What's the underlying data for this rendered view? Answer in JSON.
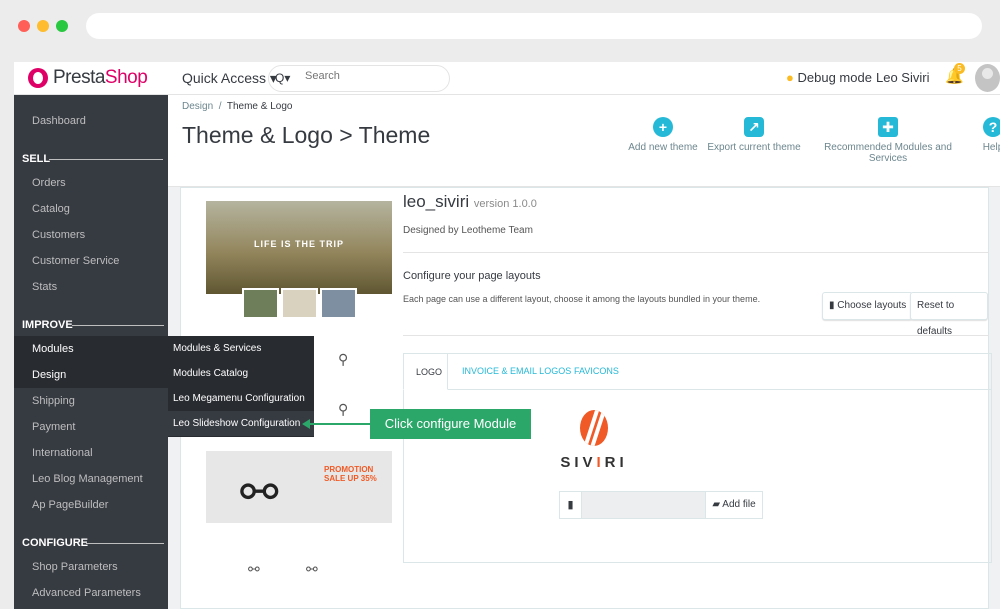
{
  "topbar": {
    "logo_pre": "Presta",
    "logo_post": "Shop",
    "quick_access": "Quick Access ▾",
    "search_icon": "Q▾",
    "search_placeholder": "Search",
    "debug_mode": "Debug mode",
    "user_name": "Leo Siviri",
    "notification_count": "5"
  },
  "sidebar": {
    "items": [
      {
        "label": "Dashboard"
      },
      {
        "label": "Orders"
      },
      {
        "label": "Catalog"
      },
      {
        "label": "Customers"
      },
      {
        "label": "Customer Service"
      },
      {
        "label": "Stats"
      },
      {
        "label": "Modules"
      },
      {
        "label": "Design"
      },
      {
        "label": "Shipping"
      },
      {
        "label": "Payment"
      },
      {
        "label": "International"
      },
      {
        "label": "Leo Blog Management"
      },
      {
        "label": "Ap PageBuilder"
      },
      {
        "label": "Shop Parameters"
      },
      {
        "label": "Advanced Parameters"
      }
    ],
    "sections": [
      "SELL",
      "IMPROVE",
      "CONFIGURE"
    ]
  },
  "flyout": {
    "items": [
      {
        "label": "Modules & Services"
      },
      {
        "label": "Modules Catalog"
      },
      {
        "label": "Leo Megamenu Configuration"
      },
      {
        "label": "Leo Slideshow Configuration"
      }
    ]
  },
  "header": {
    "breadcrumb_parent": "Design",
    "breadcrumb_sep": "/",
    "breadcrumb_current": "Theme & Logo",
    "title": "Theme & Logo > Theme",
    "toolbar": [
      {
        "label": "Add new theme",
        "icon": "+"
      },
      {
        "label": "Export current theme",
        "icon": "↗"
      },
      {
        "label": "Recommended Modules and Services",
        "icon": "✚"
      },
      {
        "label": "Help",
        "icon": "?"
      }
    ]
  },
  "preview": {
    "hero_text": "LIFE IS THE TRIP",
    "promo_text": "PROMOTION SALE UP 35%"
  },
  "theme": {
    "name": "leo_siviri",
    "version": "version 1.0.0",
    "designer": "Designed by Leotheme Team",
    "layouts_title": "Configure your page layouts",
    "layouts_text": "Each page can use a different layout, choose it among the layouts bundled in your theme.",
    "choose_layouts": "Choose layouts",
    "reset_defaults": "Reset to defaults"
  },
  "tabs": [
    {
      "label": "LOGO"
    },
    {
      "label": "INVOICE & EMAIL LOGOS"
    },
    {
      "label": "FAVICONS"
    }
  ],
  "logo": {
    "brand_pre": "SIV",
    "brand_i": "I",
    "brand_post": "RI",
    "add_file": "Add file"
  },
  "callout": {
    "text": "Click configure Module"
  },
  "colors": {
    "accent": "#25b9d7",
    "sidebar": "#363a41",
    "callout": "#2ca76a",
    "brand": "#f05a26"
  }
}
